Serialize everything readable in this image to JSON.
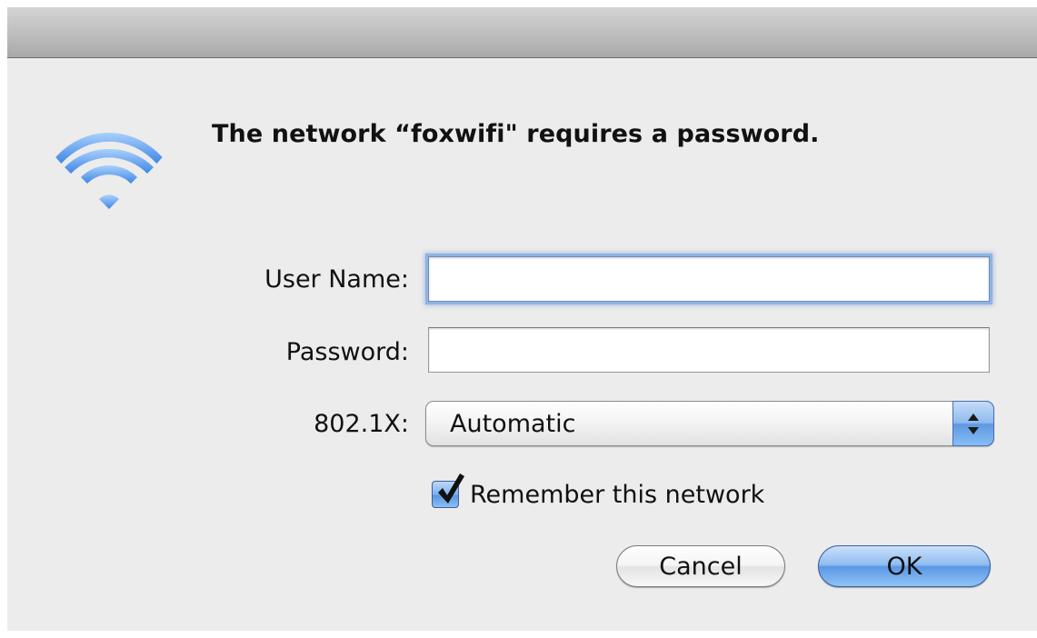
{
  "dialog": {
    "message": "The network “foxwifi\" requires a password.",
    "icon": "wifi-icon"
  },
  "form": {
    "username": {
      "label": "User Name:",
      "value": ""
    },
    "password": {
      "label": "Password:",
      "value": ""
    },
    "security": {
      "label": "802.1X:",
      "selected": "Automatic"
    },
    "remember": {
      "label": "Remember this network",
      "checked": true
    }
  },
  "buttons": {
    "cancel_label": "Cancel",
    "ok_label": "OK"
  },
  "colors": {
    "background": "#ececec",
    "accent": "#5b98e4",
    "wifi_icon": "#6aa8ef"
  }
}
